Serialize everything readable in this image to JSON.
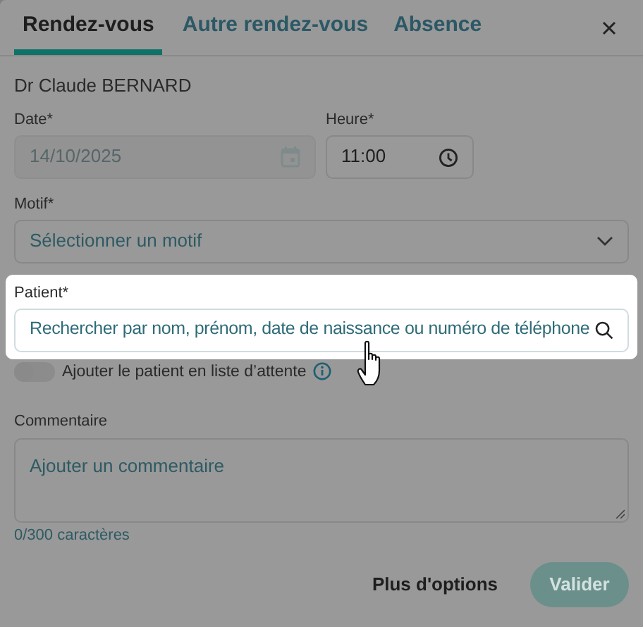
{
  "tabs": [
    {
      "label": "Rendez-vous",
      "selected": true
    },
    {
      "label": "Autre rendez-vous",
      "selected": false
    },
    {
      "label": "Absence",
      "selected": false
    }
  ],
  "practitioner": "Dr Claude BERNARD",
  "date": {
    "label": "Date*",
    "value": "14/10/2025",
    "disabled": true
  },
  "time": {
    "label": "Heure*",
    "value": "11:00"
  },
  "reason": {
    "label": "Motif*",
    "placeholder": "Sélectionner un motif"
  },
  "patient": {
    "label": "Patient*",
    "placeholder": "Rechercher par nom, prénom, date de naissance ou numéro de téléphone",
    "highlighted": true
  },
  "waitlist": {
    "label": "Ajouter le patient en liste d’attente",
    "on": false
  },
  "comment": {
    "label": "Commentaire",
    "placeholder": "Ajouter un commentaire",
    "counter": "0/300 caractères"
  },
  "buttons": [
    {
      "label": "Plus d'options",
      "kind": "link"
    },
    {
      "label": "Valider",
      "kind": "primary",
      "disabled": true
    }
  ]
}
